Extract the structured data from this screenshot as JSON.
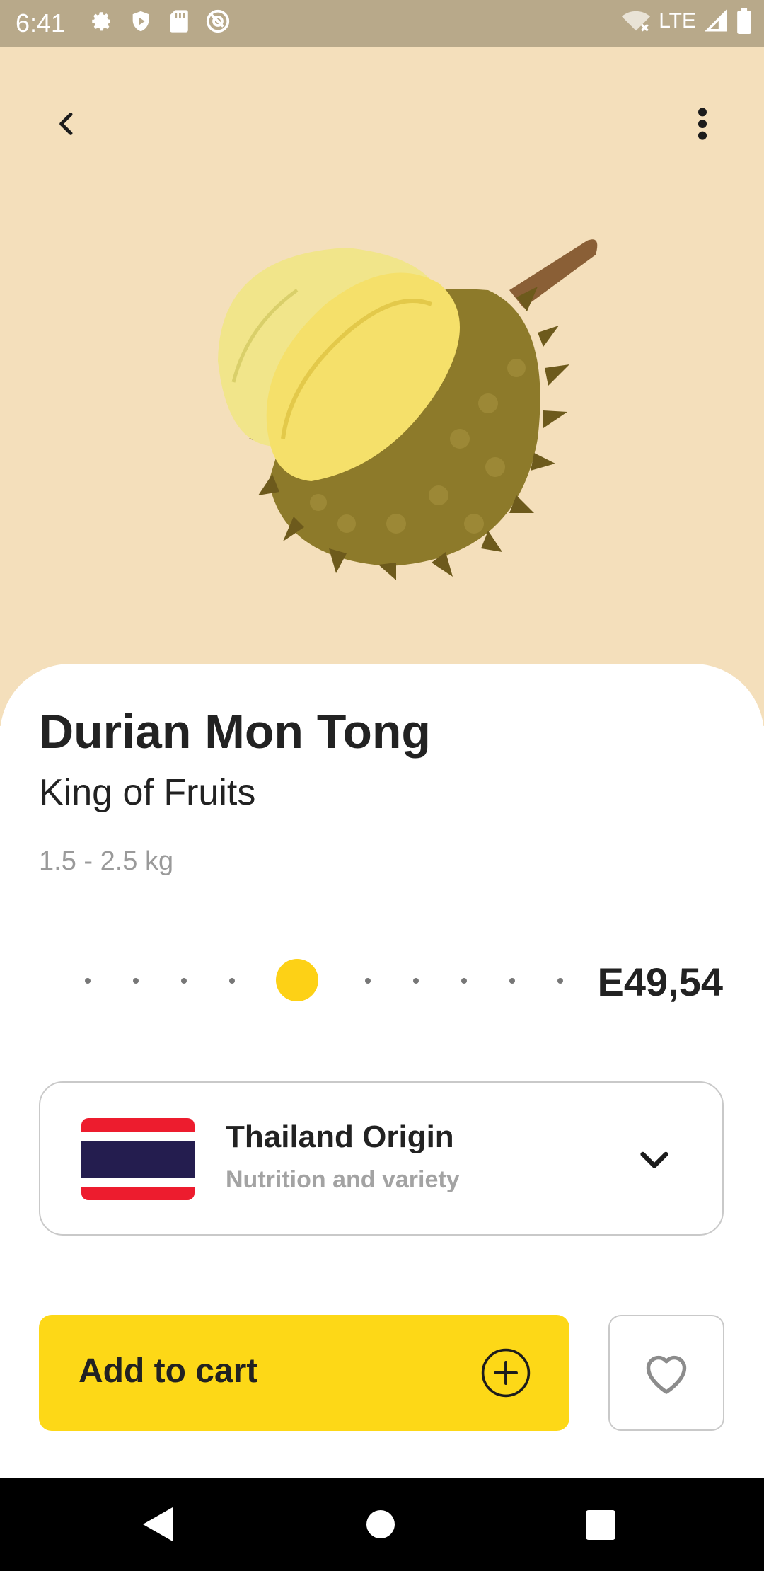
{
  "status_bar": {
    "time": "6:41",
    "network": "LTE",
    "icons": [
      "settings-icon",
      "shield-play-icon",
      "sd-card-icon",
      "at-sign-icon",
      "wifi-off-icon",
      "signal-icon",
      "battery-icon"
    ]
  },
  "top_bar": {
    "back_icon": "chevron-left-icon",
    "menu_icon": "more-vertical-icon"
  },
  "product": {
    "name": "Durian Mon Tong",
    "tagline": "King of Fruits",
    "weight": "1.5 - 2.5 kg",
    "price": "E49,54",
    "quantity_dots_total": 11,
    "quantity_selected_index": 4
  },
  "origin": {
    "title": "Thailand Origin",
    "subtitle": "Nutrition and variety",
    "flag_icon": "thailand-flag-icon",
    "toggle_icon": "chevron-down-icon"
  },
  "actions": {
    "add_to_cart": "Add to cart",
    "add_icon": "plus-circle-icon",
    "favorite_icon": "heart-icon"
  },
  "colors": {
    "hero_bg": "#f4dfbb",
    "accent": "#fdd817",
    "status_bar": "#b8a98a"
  }
}
